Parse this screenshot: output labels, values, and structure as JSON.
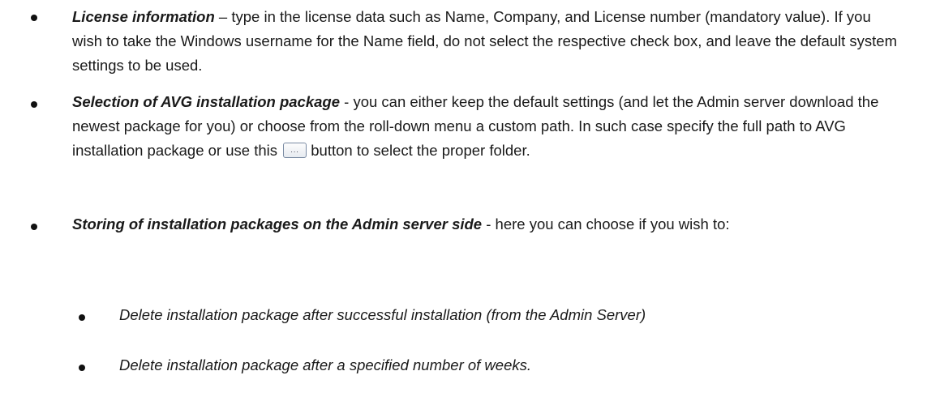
{
  "items": [
    {
      "term": "License information",
      "separator": " – ",
      "text": "type in the license data such as Name, Company, and License number (mandatory value). If you wish to take the Windows username for the Name field, do not select the respective check box, and leave the default system settings to be used."
    },
    {
      "term": "Selection of AVG installation package",
      "separator": " - ",
      "text_before_button": "you can either keep the default settings (and let the Admin server download the newest package for you) or choose from the roll-down menu a custom path. In such case specify the full path to AVG installation package or use this",
      "button_label": "...",
      "text_after_button": "button to select the proper folder."
    },
    {
      "term": "Storing of installation packages on the Admin server side",
      "separator": " - ",
      "text": "here you can choose if you wish to:",
      "subitems": [
        "Delete installation package after successful installation (from the Admin Server)",
        "Delete installation package after a specified number of weeks."
      ]
    }
  ]
}
